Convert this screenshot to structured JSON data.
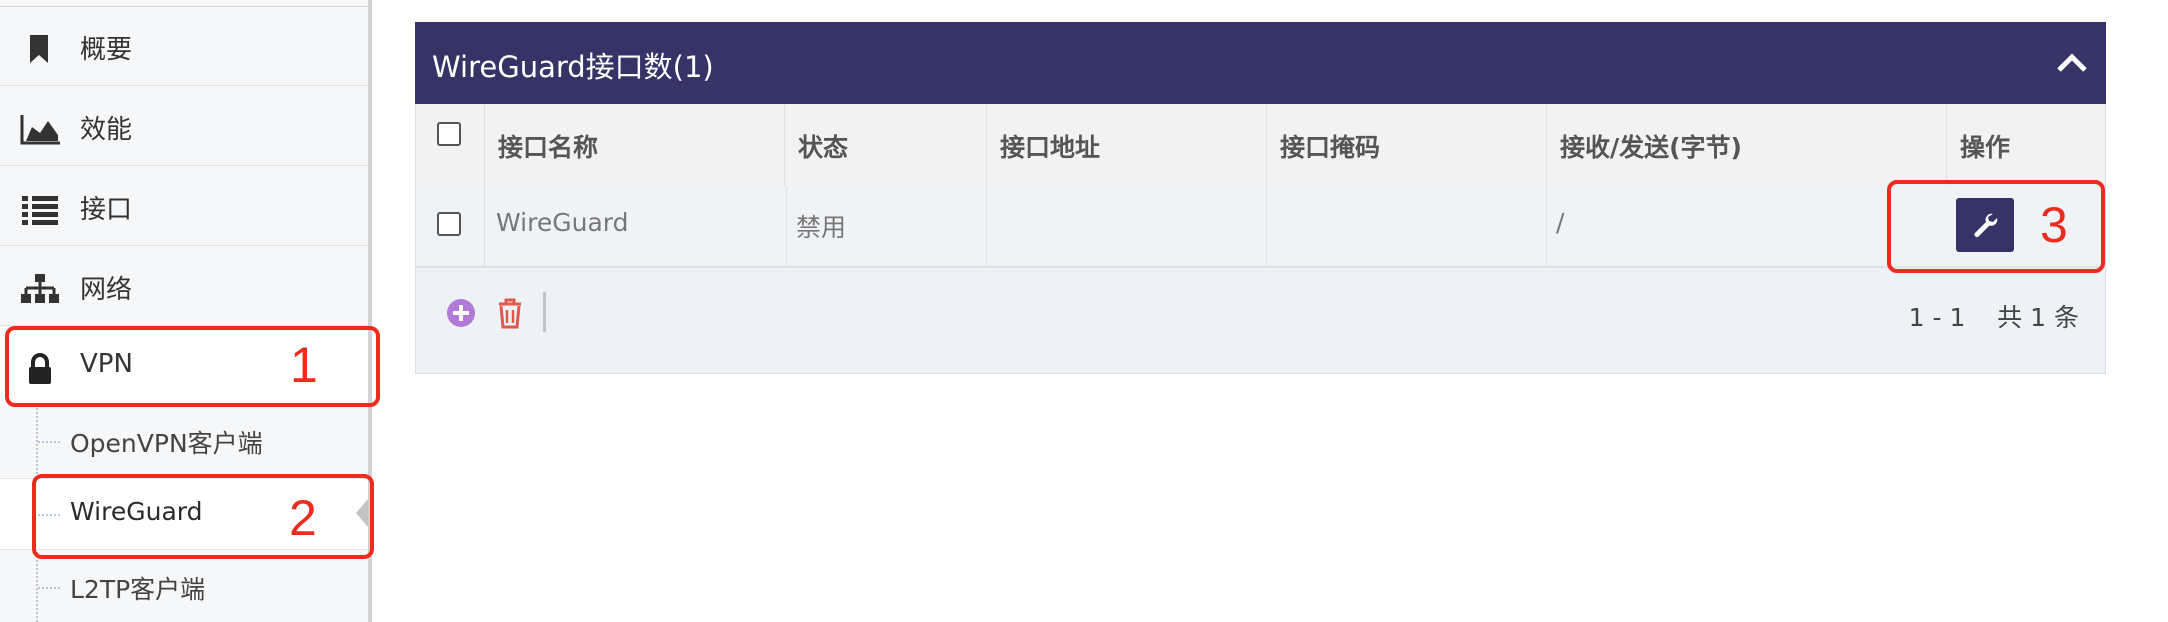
{
  "sidebar": {
    "items": [
      {
        "label": "概要",
        "icon": "bookmark-icon"
      },
      {
        "label": "效能",
        "icon": "area-chart-icon"
      },
      {
        "label": "接口",
        "icon": "list-icon"
      },
      {
        "label": "网络",
        "icon": "sitemap-icon"
      },
      {
        "label": "VPN",
        "icon": "lock-icon"
      }
    ],
    "submenu": [
      {
        "label": "OpenVPN客户端"
      },
      {
        "label": "WireGuard"
      },
      {
        "label": "L2TP客户端"
      }
    ]
  },
  "panel": {
    "title": "WireGuard接口数(1)",
    "columns": [
      "接口名称",
      "状态",
      "接口地址",
      "接口掩码",
      "接收/发送(字节)",
      "操作"
    ],
    "rows": [
      {
        "name": "WireGuard",
        "status": "禁用",
        "address": "",
        "mask": "",
        "rx_tx": "/"
      }
    ],
    "pager": "1 - 1    共 1 条"
  },
  "annotations": [
    "1",
    "2",
    "3"
  ],
  "colors": {
    "header_bg": "#363466",
    "callout": "#ee2b1c",
    "add_icon": "#b07ad6",
    "trash_icon": "#e0584a"
  }
}
